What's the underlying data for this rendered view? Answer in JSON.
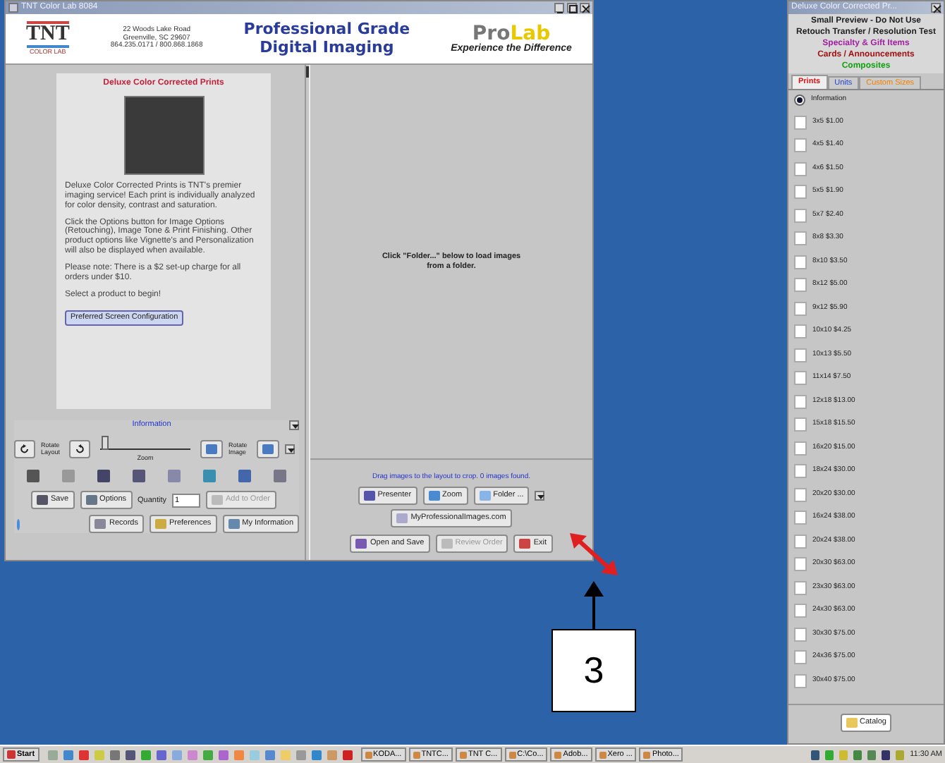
{
  "main_window": {
    "title": "TNT Color Lab 8084",
    "header": {
      "logo_text": "TNT",
      "logo_subtext": "COLOR LAB",
      "address": [
        "22 Woods Lake Road",
        "Greenville, SC 29607",
        "864.235.0171 / 800.868.1868"
      ],
      "headline": [
        "Professional Grade",
        "Digital Imaging"
      ],
      "brand_part_1": "Pro",
      "brand_part_2": "Lab",
      "tagline": "Experience the Difference"
    },
    "product_card": {
      "title": "Deluxe Color Corrected Prints",
      "paragraphs": [
        "Deluxe Color Corrected Prints is TNT's premier imaging service! Each print is individually analyzed for color density, contrast and saturation.",
        "Click the Options button for Image Options (Retouching), Image Tone & Print Finishing. Other product options like Vignette's and Personalization will also be displayed when available.",
        "Please note: There is a $2 set-up charge for all orders under $10.",
        "Select a product to begin!"
      ],
      "button": "Preferred Screen Configuration"
    },
    "controls": {
      "info_link": "Information",
      "rotate_layout": "Rotate Layout",
      "zoom_label": "Zoom",
      "zoom": {
        "level": 0.05
      },
      "rotate_image": "Rotate Image",
      "buttons": [
        {
          "label": "Save",
          "disabled": false
        },
        {
          "label": "Options",
          "disabled": false
        }
      ],
      "quantity_label": "Quantity",
      "quantity": "1",
      "add_button": {
        "label": "Add to Order",
        "disabled": true
      },
      "bottom_buttons": [
        {
          "label": "Records",
          "disabled": false
        },
        {
          "label": "Preferences",
          "disabled": false
        },
        {
          "label": "My Information",
          "disabled": false
        }
      ]
    },
    "canvas": {
      "message": "Click \"Folder...\" below to load images from a folder.",
      "status": "Drag images to the layout to crop. 0 images found.",
      "buttons": [
        {
          "label": "Presenter",
          "disabled": false
        },
        {
          "label": "Zoom",
          "disabled": false
        },
        {
          "label": "Folder ...",
          "disabled": false
        }
      ],
      "website_button": "MyProfessionalImages.com",
      "bottom_buttons": [
        {
          "label": "Open and Save",
          "disabled": false
        },
        {
          "label": "Review Order",
          "disabled": true
        },
        {
          "label": "Exit",
          "disabled": false
        }
      ]
    }
  },
  "side_window": {
    "title": "Deluxe Color Corrected Pr...",
    "links": [
      {
        "text": "Small Preview - **Do Not Use**",
        "color": "#202020"
      },
      {
        "text": "Retouch Transfer / Resolution Test",
        "color": "#202020"
      },
      {
        "text": "Specialty & Gift Items",
        "color": "#a020a0"
      },
      {
        "text": "Cards / Announcements",
        "color": "#a01010"
      },
      {
        "text": "Composites",
        "color": "#10a010"
      }
    ],
    "tabs": [
      {
        "label": "Prints",
        "selected": true,
        "color": "#e01010"
      },
      {
        "label": "Units",
        "selected": false,
        "color": "#2040d0"
      },
      {
        "label": "Custom Sizes",
        "selected": false,
        "color": "#f08000"
      }
    ],
    "items": [
      {
        "kind": "radio",
        "label": "Information",
        "checked": true
      },
      {
        "kind": "check",
        "label": "3x5 $1.00",
        "checked": false
      },
      {
        "kind": "check",
        "label": "4x5 $1.40",
        "checked": false
      },
      {
        "kind": "check",
        "label": "4x6 $1.50",
        "checked": false
      },
      {
        "kind": "check",
        "label": "5x5 $1.90",
        "checked": false
      },
      {
        "kind": "check",
        "label": "5x7 $2.40",
        "checked": false
      },
      {
        "kind": "check",
        "label": "8x8 $3.30",
        "checked": false
      },
      {
        "kind": "check",
        "label": "8x10 $3.50",
        "checked": false
      },
      {
        "kind": "check",
        "label": "8x12 $5.00",
        "checked": false
      },
      {
        "kind": "check",
        "label": "9x12 $5.90",
        "checked": false
      },
      {
        "kind": "check",
        "label": "10x10 $4.25",
        "checked": false
      },
      {
        "kind": "check",
        "label": "10x13 $5.50",
        "checked": false
      },
      {
        "kind": "check",
        "label": "11x14 $7.50",
        "checked": false
      },
      {
        "kind": "check",
        "label": "12x18 $13.00",
        "checked": false
      },
      {
        "kind": "check",
        "label": "15x18 $15.50",
        "checked": false
      },
      {
        "kind": "check",
        "label": "16x20 $15.00",
        "checked": false
      },
      {
        "kind": "check",
        "label": "18x24 $30.00",
        "checked": false
      },
      {
        "kind": "check",
        "label": "20x20 $30.00",
        "checked": false
      },
      {
        "kind": "check",
        "label": "16x24 $38.00",
        "checked": false
      },
      {
        "kind": "check",
        "label": "20x24 $38.00",
        "checked": false
      },
      {
        "kind": "check",
        "label": "20x30 $63.00",
        "checked": false
      },
      {
        "kind": "check",
        "label": "23x30 $63.00",
        "checked": false
      },
      {
        "kind": "check",
        "label": "24x30 $63.00",
        "checked": false
      },
      {
        "kind": "check",
        "label": "30x30 $75.00",
        "checked": false
      },
      {
        "kind": "check",
        "label": "24x36 $75.00",
        "checked": false
      },
      {
        "kind": "check",
        "label": "30x40 $75.00",
        "checked": false
      }
    ],
    "catalog_button": "Catalog"
  },
  "callout": {
    "number": "3"
  },
  "taskbar": {
    "start": "Start",
    "tasks": [
      "KODA...",
      "TNTC...",
      "TNT C...",
      "C:\\Co...",
      "Adob...",
      "Xero ...",
      "Photo..."
    ],
    "clock": "11:30 AM"
  }
}
